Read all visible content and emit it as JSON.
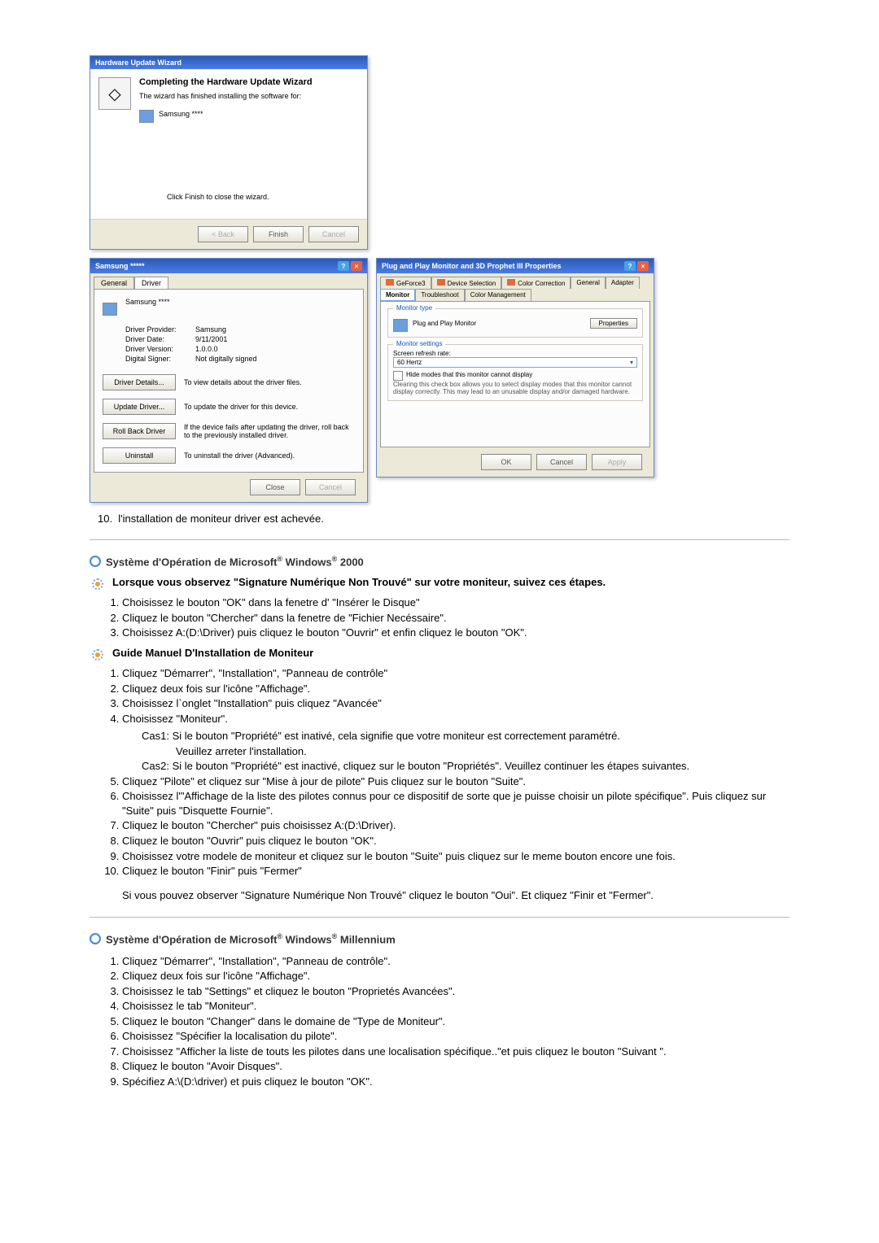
{
  "dlg1": {
    "title": "Hardware Update Wizard",
    "heading": "Completing the Hardware Update Wizard",
    "intro": "The wizard has finished installing the software for:",
    "device": "Samsung ****",
    "clickFinish": "Click Finish to close the wizard.",
    "back": "< Back",
    "finish": "Finish",
    "cancel": "Cancel"
  },
  "dlg2": {
    "title": "Samsung *****",
    "tabGeneral": "General",
    "tabDriver": "Driver",
    "device": "Samsung ****",
    "providerLabel": "Driver Provider:",
    "provider": "Samsung",
    "dateLabel": "Driver Date:",
    "date": "9/11/2001",
    "versionLabel": "Driver Version:",
    "version": "1.0.0.0",
    "signerLabel": "Digital Signer:",
    "signer": "Not digitally signed",
    "details": "Driver Details...",
    "detailsDesc": "To view details about the driver files.",
    "update": "Update Driver...",
    "updateDesc": "To update the driver for this device.",
    "rollback": "Roll Back Driver",
    "rollbackDesc": "If the device fails after updating the driver, roll back to the previously installed driver.",
    "uninstall": "Uninstall",
    "uninstallDesc": "To uninstall the driver (Advanced).",
    "close": "Close",
    "cancel": "Cancel"
  },
  "dlg3": {
    "title": "Plug and Play Monitor and 3D Prophet III Properties",
    "tabs": {
      "geforce": "GeForce3",
      "devsel": "Device Selection",
      "colcor": "Color Correction",
      "general": "General",
      "adapter": "Adapter",
      "monitor": "Monitor",
      "troubleshoot": "Troubleshoot",
      "colmg": "Color Management"
    },
    "grpType": "Monitor type",
    "monName": "Plug and Play Monitor",
    "properties": "Properties",
    "grpSettings": "Monitor settings",
    "refreshLabel": "Screen refresh rate:",
    "refresh": "60 Hertz",
    "hideModes": "Hide modes that this monitor cannot display",
    "hideNote": "Clearing this check box allows you to select display modes that this monitor cannot display correctly. This may lead to an unusable display and/or damaged hardware.",
    "ok": "OK",
    "cancel": "Cancel",
    "apply": "Apply"
  },
  "item10": "l'installation de moniteur driver est achevée.",
  "sec2000": {
    "title": "Système d'Opération de Microsoft® Windows® 2000",
    "lead": "Lorsque vous observez \"Signature Numérique Non Trouvé\" sur votre moniteur, suivez ces étapes.",
    "s1": "Choisissez le bouton \"OK\" dans la fenetre d' \"Insérer le Disque\"",
    "s2": "Cliquez le bouton \"Chercher\" dans la fenetre de \"Fichier Necéssaire\".",
    "s3": "Choisissez A:(D:\\Driver) puis cliquez le bouton \"Ouvrir\" et enfin cliquez le bouton \"OK\".",
    "guide": "Guide Manuel D'Installation de Moniteur",
    "g1": "Cliquez \"Démarrer\", \"Installation\", \"Panneau de contrôle\"",
    "g2": "Cliquez deux fois sur l'icône \"Affichage\".",
    "g3": "Choisissez l`onglet \"Installation\" puis cliquez \"Avancée\"",
    "g4": "Choisissez \"Moniteur\".",
    "g4c1": "Cas1:  Si le bouton \"Propriété\" est inativé, cela signifie que votre moniteur est correctement paramétré.",
    "g4c1b": "Veuillez arreter l'installation.",
    "g4c2": "Cas2:  Si le bouton \"Propriété\" est inactivé, cliquez sur le bouton \"Propriétés\". Veuillez continuer les étapes suivantes.",
    "g5": "Cliquez \"Pilote\" et cliquez sur \"Mise à jour de pilote\" Puis cliquez sur le bouton \"Suite\".",
    "g6": "Choisissez l'\"Affichage de la liste des pilotes connus pour ce dispositif de sorte que je puisse choisir un pilote spécifique\". Puis cliquez sur \"Suite\" puis \"Disquette Fournie\".",
    "g7": "Cliquez le bouton \"Chercher\" puis choisissez A:(D:\\Driver).",
    "g8": "Cliquez le bouton \"Ouvrir\" puis cliquez le bouton \"OK\".",
    "g9": "Choisissez votre modele de moniteur et cliquez sur le bouton \"Suite\" puis cliquez sur le meme bouton encore une fois.",
    "g10": "Cliquez le bouton \"Finir\" puis \"Fermer\"",
    "g10b": "Si vous pouvez observer \"Signature Numérique Non Trouvé\" cliquez le bouton \"Oui\". Et cliquez \"Finir et \"Fermer\"."
  },
  "secMill": {
    "title": "Système d'Opération de Microsoft® Windows® Millennium",
    "m1": "Cliquez \"Démarrer\", \"Installation\", \"Panneau de contrôle\".",
    "m2": "Cliquez deux fois sur l'icône \"Affichage\".",
    "m3": "Choisissez le tab \"Settings\" et cliquez le bouton \"Proprietés Avancées\".",
    "m4": "Choisissez le tab \"Moniteur\".",
    "m5": "Cliquez le bouton \"Changer\" dans le domaine de \"Type de Moniteur\".",
    "m6": "Choisissez \"Spécifier la localisation du pilote\".",
    "m7": "Choisissez \"Afficher la liste de touts les pilotes dans une localisation spécifique..\"et puis cliquez le bouton \"Suivant \".",
    "m8": "Cliquez le bouton \"Avoir Disques\".",
    "m9": "Spécifiez A:\\(D:\\driver) et puis cliquez le bouton \"OK\"."
  }
}
